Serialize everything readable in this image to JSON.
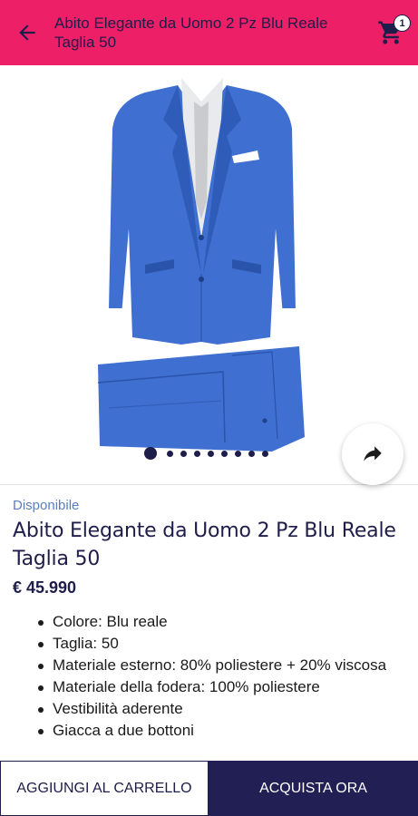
{
  "header": {
    "title": "Abito Elegante da Uomo 2 Pz Blu Reale Taglia 50",
    "back_icon": "arrow-left-icon",
    "cart_icon": "shopping-cart-icon",
    "cart_count": "1"
  },
  "gallery": {
    "image": "blue-suit-photo",
    "image_count": 9,
    "active_index": 0,
    "share_icon": "share-arrow-icon"
  },
  "product": {
    "availability": "Disponibile",
    "name": "Abito Elegante da Uomo 2 Pz Blu Reale Taglia 50",
    "price": "€ 45.990",
    "features": [
      "Colore: Blu reale",
      "Taglia: 50",
      "Materiale esterno: 80% poliestere + 20% viscosa",
      "Materiale della fodera: 100% poliestere",
      "Vestibilità aderente",
      "Giacca a due bottoni"
    ]
  },
  "actions": {
    "add_to_cart": "AGGIUNGI AL CARRELLO",
    "buy_now": "ACQUISTA ORA"
  },
  "colors": {
    "header_bg": "#ec1f67",
    "navy": "#1f1d4a",
    "availability": "#5a7fc0",
    "suit_blue": "#3f6fd0"
  }
}
